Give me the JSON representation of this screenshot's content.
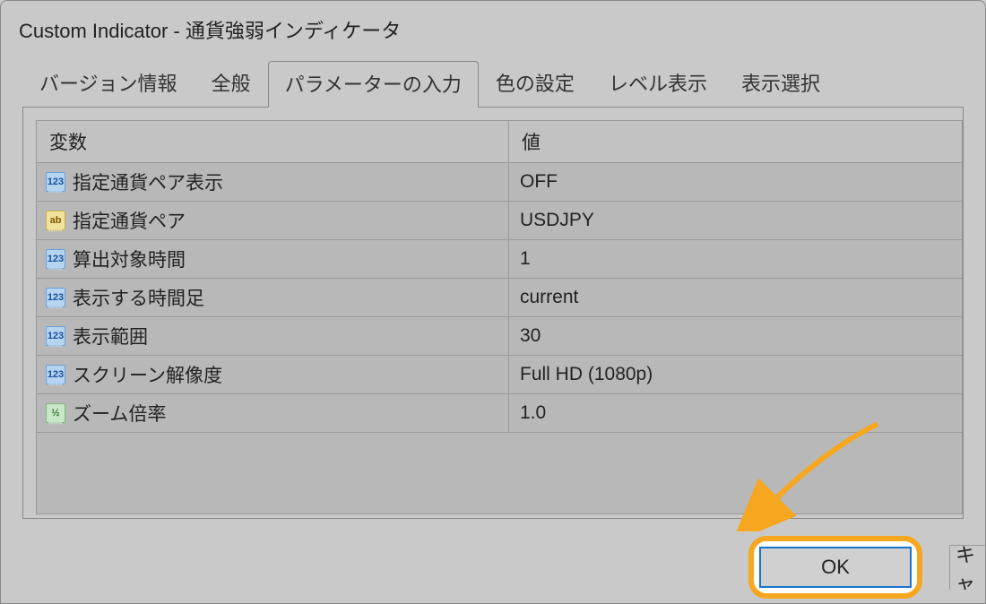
{
  "window": {
    "title": "Custom Indicator - 通貨強弱インディケータ"
  },
  "tabs": [
    {
      "label": "バージョン情報"
    },
    {
      "label": "全般"
    },
    {
      "label": "パラメーターの入力"
    },
    {
      "label": "色の設定"
    },
    {
      "label": "レベル表示"
    },
    {
      "label": "表示選択"
    }
  ],
  "grid": {
    "headers": {
      "var": "変数",
      "val": "値"
    },
    "rows": [
      {
        "icon": "num",
        "name": "指定通貨ペア表示",
        "value": "OFF"
      },
      {
        "icon": "str",
        "name": "指定通貨ペア",
        "value": "USDJPY"
      },
      {
        "icon": "num",
        "name": "算出対象時間",
        "value": "1"
      },
      {
        "icon": "num",
        "name": "表示する時間足",
        "value": "current"
      },
      {
        "icon": "num",
        "name": "表示範囲",
        "value": "30"
      },
      {
        "icon": "num",
        "name": "スクリーン解像度",
        "value": "Full HD (1080p)"
      },
      {
        "icon": "half",
        "name": "ズーム倍率",
        "value": "1.0"
      }
    ]
  },
  "buttons": {
    "ok": "OK",
    "cancel_partial": "キャ"
  },
  "icons": {
    "num": "123",
    "str": "ab",
    "half": "½"
  }
}
